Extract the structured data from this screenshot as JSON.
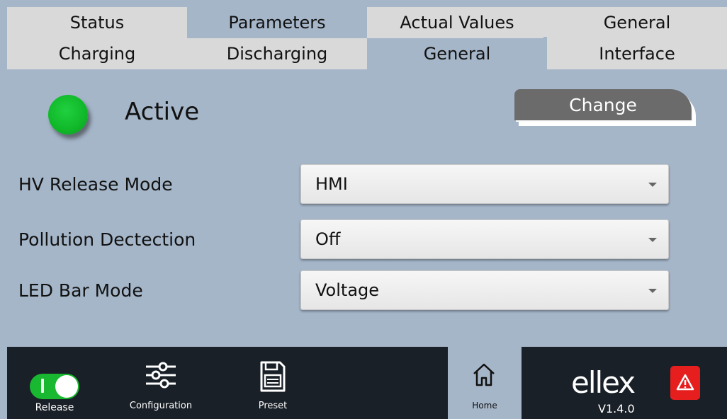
{
  "tabs": {
    "row1": [
      "Status",
      "Parameters",
      "Actual Values",
      "General"
    ],
    "row2": [
      "Charging",
      "Discharging",
      "General",
      "Interface"
    ]
  },
  "status": {
    "label": "Active",
    "indicator_color": "#16c02f"
  },
  "change_button": {
    "label": "Change"
  },
  "form": {
    "hv_release_mode": {
      "label": "HV Release Mode",
      "value": "HMI"
    },
    "pollution_detection": {
      "label": "Pollution Dectection",
      "value": "Off"
    },
    "led_bar_mode": {
      "label": "LED Bar Mode",
      "value": "Voltage"
    }
  },
  "bottom_bar": {
    "release": {
      "label": "Release",
      "icon": "toggle-switch-icon",
      "state": "on"
    },
    "configuration": {
      "label": "Configuration",
      "icon": "sliders-icon"
    },
    "preset": {
      "label": "Preset",
      "icon": "save-icon"
    },
    "home": {
      "label": "Home",
      "icon": "home-icon"
    },
    "brand": {
      "logo_text": "ellex",
      "version": "V1.4.0"
    },
    "warning": {
      "icon": "warning-icon",
      "color": "#e61e1e"
    }
  },
  "colors": {
    "background": "#a5b6c9",
    "tab_inactive": "#d9d9d9",
    "bottom_bar": "#1a2028",
    "button_dark": "#6b6b6b"
  }
}
